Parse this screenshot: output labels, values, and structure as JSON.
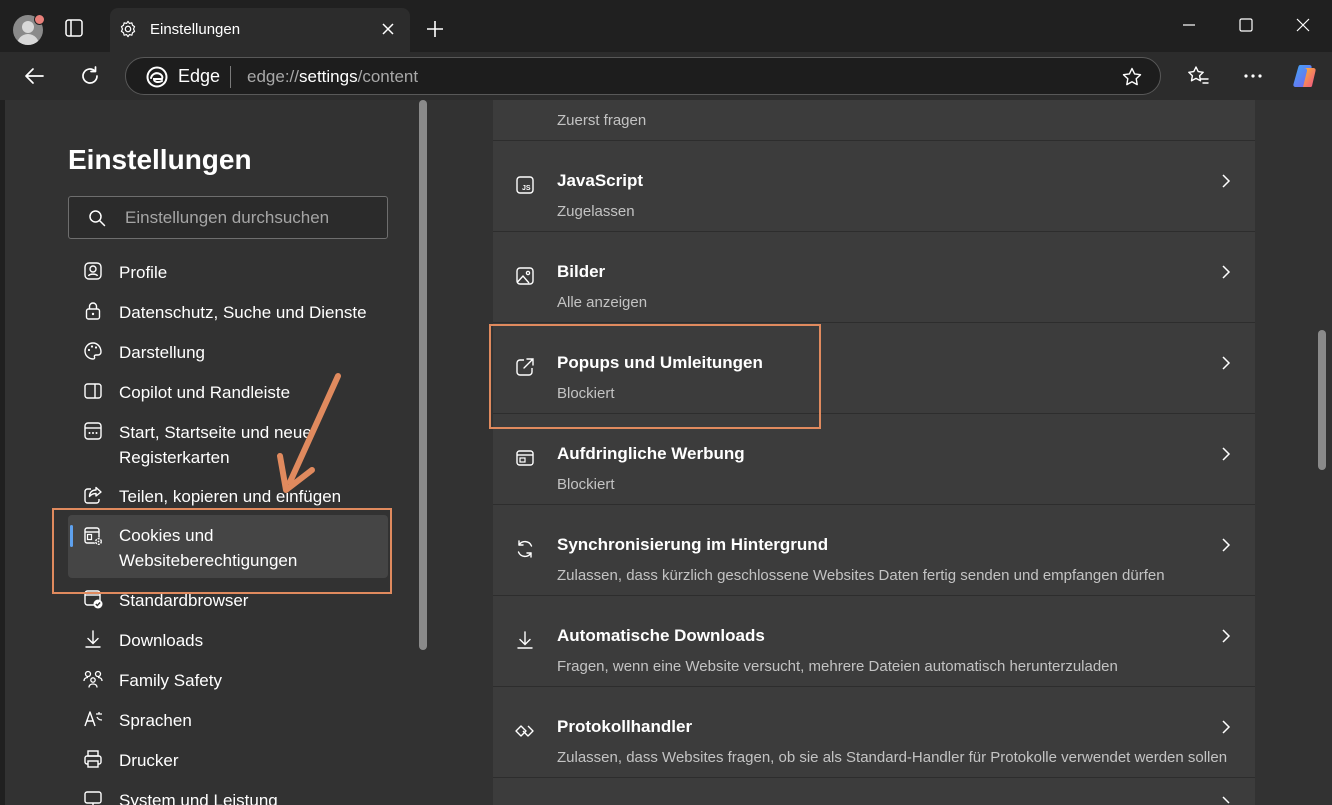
{
  "window": {
    "tab_title": "Einstellungen",
    "controls": {
      "minimize": "minimize-icon",
      "maximize": "maximize-icon",
      "close": "close-icon"
    }
  },
  "addressbar": {
    "brand": "Edge",
    "url_prefix": "edge://",
    "url_host": "settings",
    "url_path": "/content"
  },
  "sidebar": {
    "title": "Einstellungen",
    "search_placeholder": "Einstellungen durchsuchen",
    "items": [
      {
        "label": "Profile",
        "icon": "profile-icon"
      },
      {
        "label": "Datenschutz, Suche und Dienste",
        "icon": "lock-icon"
      },
      {
        "label": "Darstellung",
        "icon": "palette-icon"
      },
      {
        "label": "Copilot und Randleiste",
        "icon": "sidebar-panel-icon"
      },
      {
        "label": "Start, Startseite und neue Registerkarten",
        "icon": "home-grid-icon"
      },
      {
        "label": "Teilen, kopieren und einfügen",
        "icon": "share-icon"
      },
      {
        "label": "Cookies und Websiteberechtigungen",
        "icon": "cookie-settings-icon",
        "active": true
      },
      {
        "label": "Standardbrowser",
        "icon": "default-browser-icon"
      },
      {
        "label": "Downloads",
        "icon": "download-icon"
      },
      {
        "label": "Family Safety",
        "icon": "family-icon"
      },
      {
        "label": "Sprachen",
        "icon": "language-icon"
      },
      {
        "label": "Drucker",
        "icon": "printer-icon"
      },
      {
        "label": "System und Leistung",
        "icon": "system-icon"
      }
    ]
  },
  "main": {
    "top_partial_sub": "Zuerst fragen",
    "rows": [
      {
        "title": "JavaScript",
        "sub": "Zugelassen",
        "icon": "javascript-icon"
      },
      {
        "title": "Bilder",
        "sub": "Alle anzeigen",
        "icon": "image-icon"
      },
      {
        "title": "Popups und Umleitungen",
        "sub": "Blockiert",
        "icon": "popup-redirect-icon"
      },
      {
        "title": "Aufdringliche Werbung",
        "sub": "Blockiert",
        "icon": "ad-block-icon"
      },
      {
        "title": "Synchronisierung im Hintergrund",
        "sub": "Zulassen, dass kürzlich geschlossene Websites Daten fertig senden und empfangen dürfen",
        "icon": "sync-icon"
      },
      {
        "title": "Automatische Downloads",
        "sub": "Fragen, wenn eine Website versucht, mehrere Dateien automatisch herunterzuladen",
        "icon": "download-icon"
      },
      {
        "title": "Protokollhandler",
        "sub": "Zulassen, dass Websites fragen, ob sie als Standard-Handler für Protokolle verwendet werden sollen",
        "icon": "protocol-handler-icon"
      }
    ]
  },
  "colors": {
    "annotation": "#e08a5e",
    "accent": "#5ea1ee"
  }
}
